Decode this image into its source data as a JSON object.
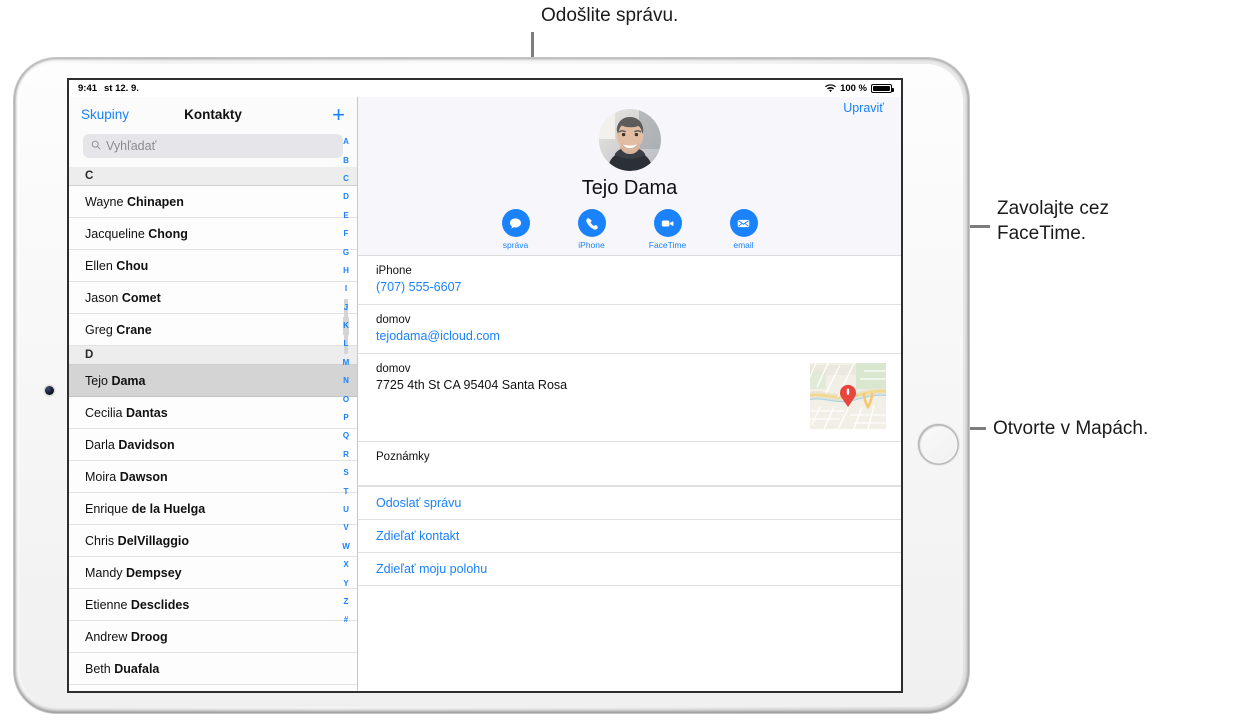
{
  "status_bar": {
    "time": "9:41",
    "date": "st 12. 9.",
    "battery_percent": "100 %",
    "wifi_icon": "wifi-icon",
    "battery_icon": "battery-full-icon"
  },
  "sidebar": {
    "groups_label": "Skupiny",
    "title": "Kontakty",
    "add_icon": "plus-icon",
    "search": {
      "placeholder": "Vyhľadať",
      "value": "",
      "icon": "search-icon"
    },
    "sections": [
      {
        "letter": "C",
        "contacts": [
          {
            "first": "Wayne",
            "last": "Chinapen"
          },
          {
            "first": "Jacqueline",
            "last": "Chong"
          },
          {
            "first": "Ellen",
            "last": "Chou"
          },
          {
            "first": "Jason",
            "last": "Comet"
          },
          {
            "first": "Greg",
            "last": "Crane"
          }
        ]
      },
      {
        "letter": "D",
        "contacts": [
          {
            "first": "Tejo",
            "last": "Dama",
            "selected": true
          },
          {
            "first": "Cecilia",
            "last": "Dantas"
          },
          {
            "first": "Darla",
            "last": "Davidson"
          },
          {
            "first": "Moira",
            "last": "Dawson"
          },
          {
            "first": "Enrique",
            "last": "de la Huelga"
          },
          {
            "first": "Chris",
            "last": "DelVillaggio"
          },
          {
            "first": "Mandy",
            "last": "Dempsey"
          },
          {
            "first": "Etienne",
            "last": "Desclides"
          },
          {
            "first": "Andrew",
            "last": "Droog"
          },
          {
            "first": "Beth",
            "last": "Duafala"
          }
        ]
      }
    ],
    "index_letters": [
      "A",
      "B",
      "C",
      "D",
      "E",
      "F",
      "G",
      "H",
      "I",
      "J",
      "K",
      "L",
      "M",
      "N",
      "O",
      "P",
      "Q",
      "R",
      "S",
      "T",
      "U",
      "V",
      "W",
      "X",
      "Y",
      "Z",
      "#"
    ],
    "index_highlight": [
      "J",
      "K",
      "L"
    ]
  },
  "detail": {
    "edit_label": "Upraviť",
    "contact_name": "Tejo Dama",
    "avatar_icon": "contact-photo",
    "actions": [
      {
        "label": "správa",
        "icon": "message-bubble-icon"
      },
      {
        "label": "iPhone",
        "icon": "phone-icon"
      },
      {
        "label": "FaceTime",
        "icon": "video-camera-icon"
      },
      {
        "label": "email",
        "icon": "envelope-icon"
      }
    ],
    "fields": [
      {
        "label": "iPhone",
        "value": "(707) 555-6607",
        "link": true
      },
      {
        "label": "domov",
        "value": "tejodama@icloud.com",
        "link": true
      },
      {
        "label": "domov",
        "value": "7725 4th St CA 95404 Santa Rosa",
        "link": false,
        "map": true
      },
      {
        "label": "Poznámky",
        "value": "",
        "link": false
      }
    ],
    "links": [
      "Odoslať správu",
      "Zdieľať kontakt",
      "Zdieľať moju polohu"
    ],
    "map_pin_icon": "map-pin-icon"
  },
  "callouts": [
    {
      "text": "Odošlite správu.",
      "name": "callout-send-message"
    },
    {
      "text": "Zavolajte cez\nFaceTime.",
      "name": "callout-facetime"
    },
    {
      "text": "Otvorte v Mapách.",
      "name": "callout-open-maps"
    }
  ],
  "colors": {
    "accent_blue": "#1a82fb",
    "selected_row": "#d4d4d4",
    "pin_red": "#e8453c"
  }
}
